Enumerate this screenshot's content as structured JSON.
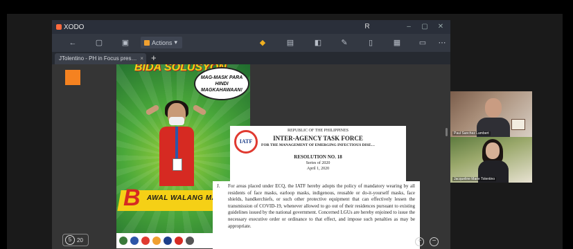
{
  "app": {
    "name": "XODO",
    "user_initial": "R",
    "window_controls": [
      "–",
      "▢",
      "✕"
    ]
  },
  "toolbar": {
    "actions_label": "Actions",
    "icons": [
      "back-icon",
      "home-icon",
      "save-icon",
      "highlight-icon",
      "comment-icon",
      "panel-icon",
      "edit-icon",
      "sidebar-icon",
      "grid-icon",
      "page-icon",
      "more-icon"
    ]
  },
  "tabs": [
    {
      "label": "JTolentino - PH in Focus pres…"
    }
  ],
  "tab_add_label": "+",
  "poster": {
    "title": "BIDA SOLUSYON",
    "bubble_text": "MAG-MASK PARA HINDI MAGKAHAWAAN!",
    "banner_letter": "B",
    "banner_text": "AWAL WALANG MASK"
  },
  "resolution": {
    "seal_text": "IATF",
    "republic": "REPUBLIC OF THE PHILIPPINES",
    "agency": "INTER-AGENCY TASK FORCE",
    "subtitle": "FOR THE MANAGEMENT OF EMERGING INFECTIOUS DISE…",
    "resolution_no": "RESOLUTION NO. 18",
    "series": "Series of 2020",
    "date": "April 1, 2020",
    "item_number": "J.",
    "item_text": "For areas placed under ECQ, the IATF hereby adopts the policy of mandatory wearing by all residents of face masks, earloop masks, indigenous, reusable or do-it-yourself masks, face shields, handkerchiefs, or such other protective equipment that can effectively lessen the transmission of COVID-19, whenever allowed to go out of their residences pursuant to existing guidelines issued by the national government. Concerned LGUs are hereby enjoined to issue the necessary executive order or ordinance to that effect, and impose such penalties as may be appropriate."
  },
  "page_indicator": {
    "current": "5",
    "total": "20"
  },
  "participants": [
    {
      "name": "Paul Sanchez Lambert"
    },
    {
      "name": "Jacqueline Marie Tolentino"
    }
  ],
  "colors": {
    "accent_orange": "#f58220",
    "app_titlebar": "#2a2f3a",
    "poster_yellow": "#f5d016",
    "poster_red": "#d62a22"
  }
}
